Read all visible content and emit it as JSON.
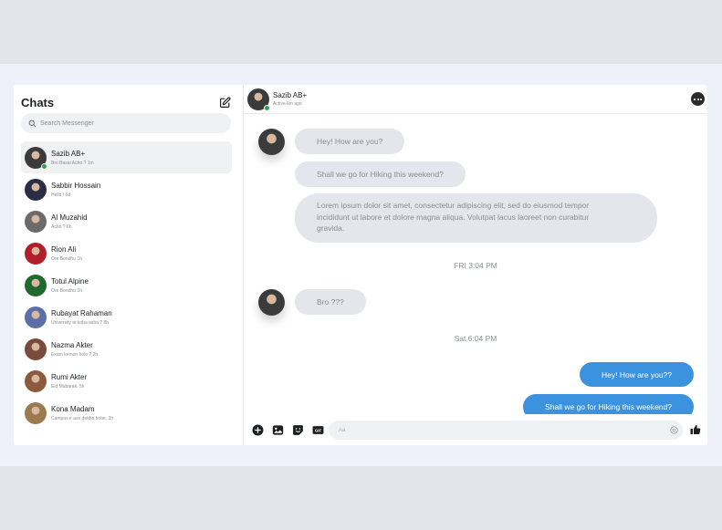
{
  "sidebar": {
    "title": "Chats",
    "search_placeholder": "Search Messenger",
    "chats": [
      {
        "name": "Sazib AB+",
        "preview": "Bro Basai Acho ? 1m",
        "avatar_color": "#3b3b3b",
        "active": true,
        "online": true
      },
      {
        "name": "Sabbir Hossain",
        "preview": "Hello ! 6d",
        "avatar_color": "#2a2d45"
      },
      {
        "name": "Al Muzahid",
        "preview": "Acho ? 6h",
        "avatar_color": "#6b6b6b"
      },
      {
        "name": "Rion Ali",
        "preview": "Ore Bondhu 1h",
        "avatar_color": "#b0202b"
      },
      {
        "name": "Totul Alpine",
        "preview": "Ore Bondhu 1h",
        "avatar_color": "#1f6b2f"
      },
      {
        "name": "Rubayat Rahaman",
        "preview": "University te koba asba ? 8h",
        "avatar_color": "#5c6fa8"
      },
      {
        "name": "Nazma Akter",
        "preview": "Exam kemon holo ? 2h",
        "avatar_color": "#7a4a3a"
      },
      {
        "name": "Rumi Akter",
        "preview": "Eid Mubarak. 5h",
        "avatar_color": "#8c5a3c"
      },
      {
        "name": "Kona Madam",
        "preview": "Campus e aso dekha hobe. 3h",
        "avatar_color": "#9c7a4e"
      }
    ]
  },
  "header": {
    "name": "Sazib AB+",
    "status": "Active 6m ago"
  },
  "messages": {
    "incoming_1": "Hey! How are you?",
    "incoming_2": "Shall we go for Hiking this weekend?",
    "incoming_3_line1": "Lorem ipsum dolor sit amet, consectetur adipiscing elit, sed do eiusmod tempor",
    "incoming_3_line2": "incididunt ut labore et dolore magna aliqua. Volutpat lacus laoreet non curabitur",
    "incoming_3_line3": "gravida.",
    "timestamp_1": "FRI 3:04 PM",
    "incoming_4": "Bro ???",
    "timestamp_2": "Sat 6:04 PM",
    "outgoing_1": "Hey! How are you??",
    "outgoing_2": "Shall we go for Hiking this weekend?"
  },
  "composer": {
    "placeholder": "Aa"
  },
  "colors": {
    "accent": "#3b93e0",
    "online": "#31a24c",
    "incoming_bubble": "#e4e6eb"
  },
  "icons": {
    "compose": "edit-icon",
    "search": "search-icon",
    "more": "more-icon",
    "add": "plus-circle-icon",
    "image": "image-icon",
    "sticker": "sticker-icon",
    "gif": "gif-icon",
    "emoji": "emoji-icon",
    "like": "thumbs-up-icon"
  }
}
